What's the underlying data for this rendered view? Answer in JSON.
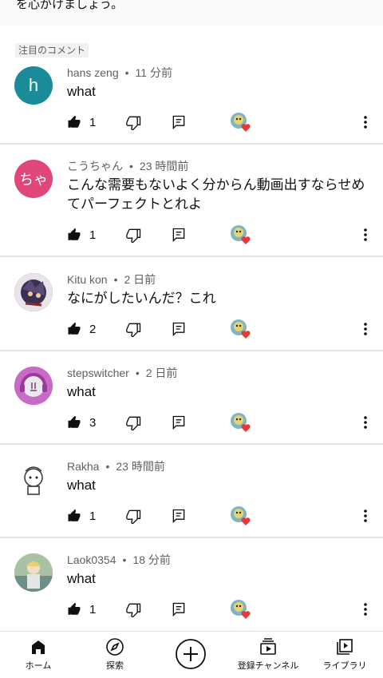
{
  "top_text": "を心がけましょう。",
  "highlight_label": "注目のコメント",
  "comments": [
    {
      "avatar_letter": "h",
      "avatar_color": "#1a8c99",
      "author": "hans zeng",
      "time": "11 分前",
      "text": "what",
      "likes": "1"
    },
    {
      "avatar_letter": "ちゃ",
      "avatar_color": "#e0457b",
      "author": "こうちゃん",
      "time": "23 時間前",
      "text": "こんな需要もないよく分からん動画出すならせめてパーフェクトとれよ",
      "likes": "1"
    },
    {
      "avatar_letter": "",
      "avatar_color": "#2b2f4a",
      "author": "Kitu kon",
      "time": "2 日前",
      "text": "なにがしたいんだ？これ",
      "likes": "2"
    },
    {
      "avatar_letter": "",
      "avatar_color": "#c76bc7",
      "author": "stepswitcher",
      "time": "2 日前",
      "text": "what",
      "likes": "3"
    },
    {
      "avatar_letter": "",
      "avatar_color": "#ffffff",
      "author": "Rakha",
      "time": "23 時間前",
      "text": "what",
      "likes": "1"
    },
    {
      "avatar_letter": "",
      "avatar_color": "#8fa88a",
      "author": "Laok0354",
      "time": "18 分前",
      "text": "what",
      "likes": "1"
    }
  ],
  "nav": {
    "home": "ホーム",
    "explore": "探索",
    "subscriptions": "登録チャンネル",
    "library": "ライブラリ"
  },
  "colors": {
    "heart": "#e53935",
    "accent_text": "#606060"
  }
}
